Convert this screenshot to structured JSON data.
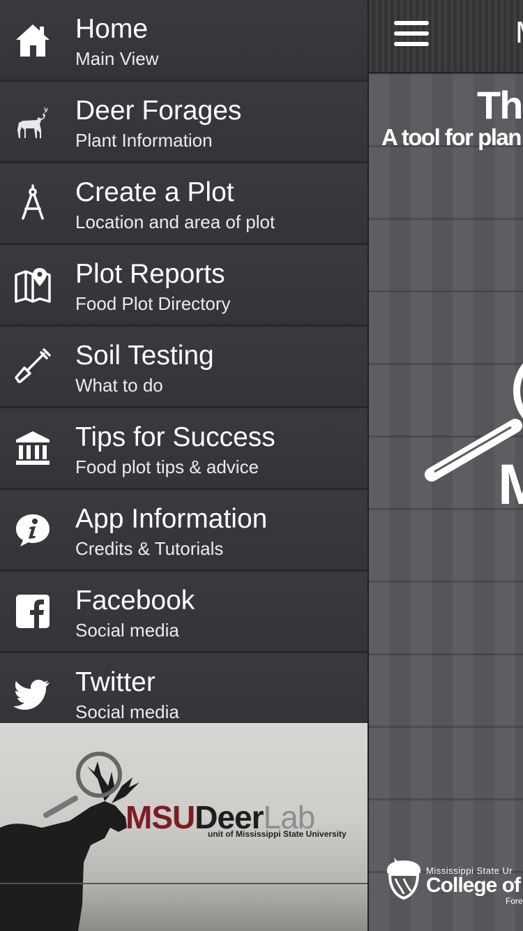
{
  "sidebar": {
    "items": [
      {
        "title": "Home",
        "subtitle": "Main View",
        "icon": "home-icon"
      },
      {
        "title": "Deer Forages",
        "subtitle": "Plant Information",
        "icon": "deer-icon"
      },
      {
        "title": "Create a Plot",
        "subtitle": "Location and area of plot",
        "icon": "compass-icon"
      },
      {
        "title": "Plot Reports",
        "subtitle": "Food Plot Directory",
        "icon": "map-pin-icon"
      },
      {
        "title": "Soil Testing",
        "subtitle": "What to do",
        "icon": "shovel-icon"
      },
      {
        "title": "Tips for Success",
        "subtitle": "Food plot tips & advice",
        "icon": "institution-icon"
      },
      {
        "title": "App Information",
        "subtitle": "Credits & Tutorials",
        "icon": "info-bubble-icon"
      },
      {
        "title": "Facebook",
        "subtitle": "Social media",
        "icon": "facebook-icon"
      },
      {
        "title": "Twitter",
        "subtitle": "Social media",
        "icon": "twitter-icon"
      }
    ],
    "banner": {
      "logo_msu": "MSU",
      "logo_deer": "Deer",
      "logo_lab": "Lab",
      "tagline": "unit of Mississippi State University"
    }
  },
  "main": {
    "topbar_title": "M",
    "hero_title": "The",
    "hero_subtitle": "A tool for plan",
    "logo_letter": "M",
    "college_top": "Mississippi State Ur",
    "college_main": "College of",
    "college_sub": "Fore"
  },
  "colors": {
    "sidebar_bg": "#35363b",
    "divider": "#26272a",
    "msu_maroon": "#7d1c25",
    "text": "#ffffff"
  }
}
